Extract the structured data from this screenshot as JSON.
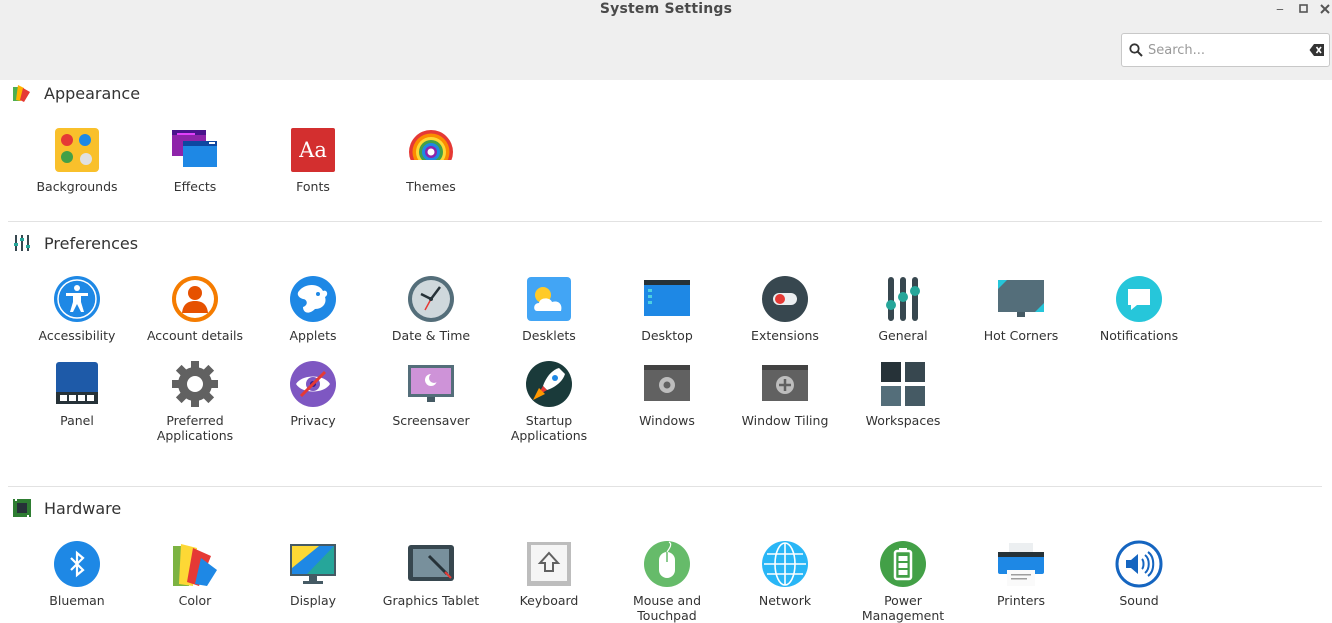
{
  "window": {
    "title": "System Settings"
  },
  "search": {
    "placeholder": "Search..."
  },
  "sections": {
    "appearance": {
      "title": "Appearance",
      "items": [
        {
          "label": "Backgrounds",
          "icon": "backgrounds-icon"
        },
        {
          "label": "Effects",
          "icon": "effects-icon"
        },
        {
          "label": "Fonts",
          "icon": "fonts-icon",
          "glyph": "Aa"
        },
        {
          "label": "Themes",
          "icon": "themes-icon"
        }
      ]
    },
    "preferences": {
      "title": "Preferences",
      "items": [
        {
          "label": "Accessibility",
          "icon": "accessibility-icon"
        },
        {
          "label": "Account details",
          "icon": "account-icon"
        },
        {
          "label": "Applets",
          "icon": "applets-icon"
        },
        {
          "label": "Date & Time",
          "icon": "clock-icon"
        },
        {
          "label": "Desklets",
          "icon": "desklets-icon"
        },
        {
          "label": "Desktop",
          "icon": "desktop-icon"
        },
        {
          "label": "Extensions",
          "icon": "extensions-icon"
        },
        {
          "label": "General",
          "icon": "sliders-icon"
        },
        {
          "label": "Hot Corners",
          "icon": "hot-corners-icon"
        },
        {
          "label": "Notifications",
          "icon": "notifications-icon"
        },
        {
          "label": "Panel",
          "icon": "panel-icon"
        },
        {
          "label": "Preferred Applications",
          "icon": "gear-icon"
        },
        {
          "label": "Privacy",
          "icon": "privacy-eye-icon"
        },
        {
          "label": "Screensaver",
          "icon": "screensaver-icon"
        },
        {
          "label": "Startup Applications",
          "icon": "rocket-icon"
        },
        {
          "label": "Windows",
          "icon": "windows-icon"
        },
        {
          "label": "Window Tiling",
          "icon": "window-tiling-icon"
        },
        {
          "label": "Workspaces",
          "icon": "workspaces-icon"
        }
      ]
    },
    "hardware": {
      "title": "Hardware",
      "items": [
        {
          "label": "Blueman",
          "icon": "bluetooth-icon"
        },
        {
          "label": "Color",
          "icon": "color-icon"
        },
        {
          "label": "Display",
          "icon": "display-icon"
        },
        {
          "label": "Graphics Tablet",
          "icon": "graphics-tablet-icon"
        },
        {
          "label": "Keyboard",
          "icon": "keyboard-icon"
        },
        {
          "label": "Mouse and Touchpad",
          "icon": "mouse-icon"
        },
        {
          "label": "Network",
          "icon": "network-globe-icon"
        },
        {
          "label": "Power Management",
          "icon": "battery-icon"
        },
        {
          "label": "Printers",
          "icon": "printer-icon"
        },
        {
          "label": "Sound",
          "icon": "speaker-icon"
        }
      ]
    }
  }
}
